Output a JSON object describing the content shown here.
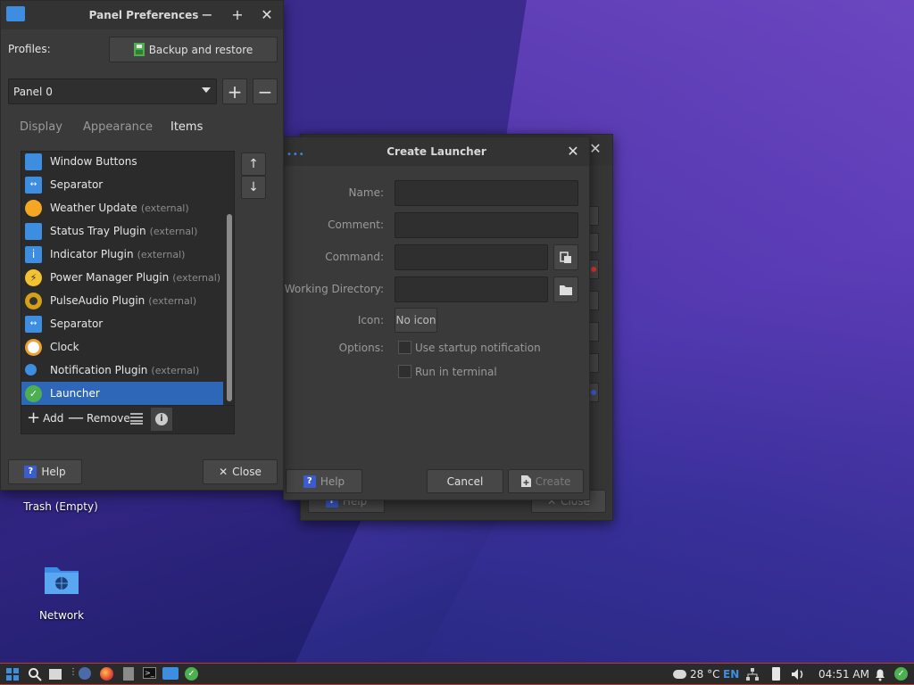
{
  "desktop": {
    "trash_label": "Trash (Empty)",
    "network_label": "Network"
  },
  "panel_prefs": {
    "title": "Panel Preferences",
    "profiles_label": "Profiles:",
    "backup_button": "Backup and restore",
    "panel_select": "Panel 0",
    "tabs": [
      {
        "label": "Display"
      },
      {
        "label": "Appearance"
      },
      {
        "label": "Items"
      }
    ],
    "items": [
      {
        "label": "Window Buttons",
        "ext": "",
        "icon": "window-buttons-icon",
        "color": "#3d8ee0"
      },
      {
        "label": "Separator",
        "ext": "",
        "icon": "separator-icon",
        "color": "#3d8ee0"
      },
      {
        "label": "Weather Update",
        "ext": "(external)",
        "icon": "weather-icon",
        "color": "#f5a623"
      },
      {
        "label": "Status Tray Plugin",
        "ext": "(external)",
        "icon": "status-tray-icon",
        "color": "#3d8ee0"
      },
      {
        "label": "Indicator Plugin",
        "ext": "(external)",
        "icon": "indicator-icon",
        "color": "#3d8ee0"
      },
      {
        "label": "Power Manager Plugin",
        "ext": "(external)",
        "icon": "power-manager-icon",
        "color": "#f2c230"
      },
      {
        "label": "PulseAudio Plugin",
        "ext": "(external)",
        "icon": "pulseaudio-icon",
        "color": "#d4a017"
      },
      {
        "label": "Separator",
        "ext": "",
        "icon": "separator-icon",
        "color": "#3d8ee0"
      },
      {
        "label": "Clock",
        "ext": "",
        "icon": "clock-icon",
        "color": "#f0a030"
      },
      {
        "label": "Notification Plugin",
        "ext": "(external)",
        "icon": "notification-icon",
        "color": "#3d8ee0"
      },
      {
        "label": "Launcher",
        "ext": "",
        "icon": "launcher-icon",
        "color": "#4caf50"
      }
    ],
    "selected_item": "Launcher",
    "add_label": "Add",
    "remove_label": "Remove",
    "help_label": "Help",
    "close_label": "Close"
  },
  "create_launcher": {
    "title": "Create Launcher",
    "name_label": "Name:",
    "comment_label": "Comment:",
    "command_label": "Command:",
    "workdir_label": "Working Directory:",
    "icon_label": "Icon:",
    "icon_button": "No icon",
    "options_label": "Options:",
    "opt_startup": "Use startup notification",
    "opt_terminal": "Run in terminal",
    "help_label": "Help",
    "cancel_label": "Cancel",
    "create_label": "Create"
  },
  "back_dialog": {
    "help_label": "Help",
    "close_label": "Close"
  },
  "taskbar": {
    "temperature": "28 °C",
    "language": "EN",
    "time": "04:51 AM"
  },
  "colors": {
    "selection": "#2f67b8",
    "taskbar_border": "#c0392b",
    "help_blue": "#3b5bcf"
  }
}
